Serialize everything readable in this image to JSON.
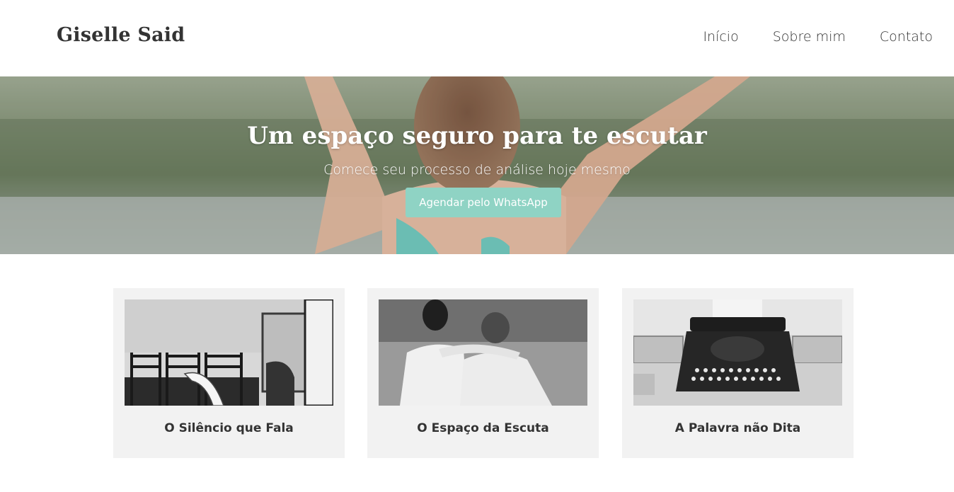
{
  "header": {
    "brand": "Giselle Said",
    "nav": [
      {
        "label": "Início"
      },
      {
        "label": "Sobre mim"
      },
      {
        "label": "Contato"
      }
    ]
  },
  "hero": {
    "title": "Um espaço seguro para te escutar",
    "subtitle": "Comece seu processo de análise hoje mesmo",
    "cta_label": "Agendar pelo WhatsApp"
  },
  "cards": [
    {
      "title": "O Silêncio que Fala",
      "image": "empty-chairs-room-photo"
    },
    {
      "title": "O Espaço da Escuta",
      "image": "two-people-embracing-photo"
    },
    {
      "title": "A Palavra não Dita",
      "image": "vintage-typewriter-photo"
    }
  ],
  "colors": {
    "accent": "#8fd3c4",
    "text": "#333333",
    "card_bg": "#f2f2f2"
  }
}
